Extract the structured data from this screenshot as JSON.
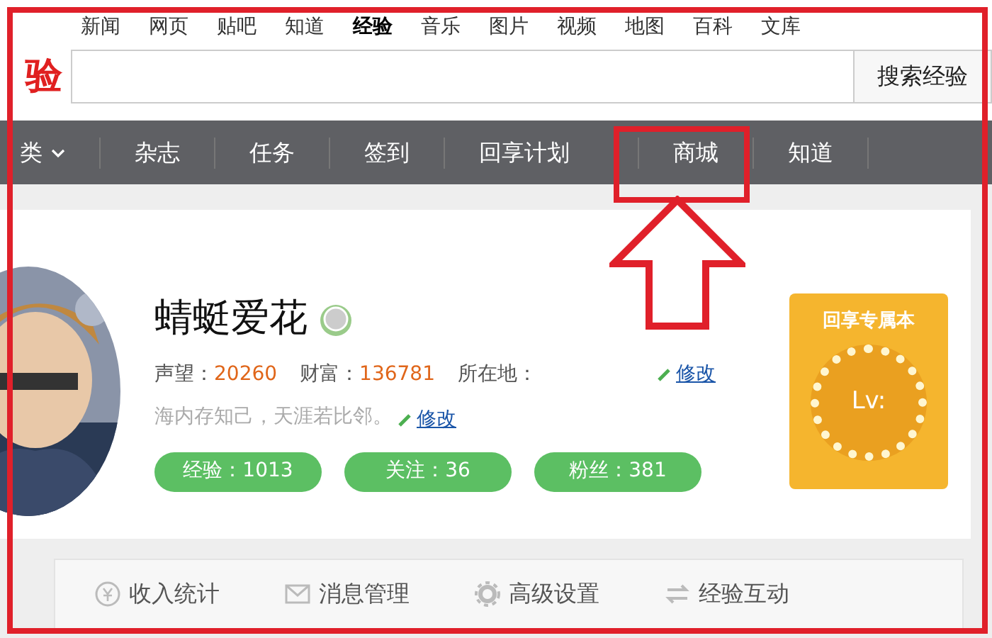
{
  "top_links": [
    {
      "label": "新闻",
      "selected": false
    },
    {
      "label": "网页",
      "selected": false
    },
    {
      "label": "贴吧",
      "selected": false
    },
    {
      "label": "知道",
      "selected": false
    },
    {
      "label": "经验",
      "selected": true
    },
    {
      "label": "音乐",
      "selected": false
    },
    {
      "label": "图片",
      "selected": false
    },
    {
      "label": "视频",
      "selected": false
    },
    {
      "label": "地图",
      "selected": false
    },
    {
      "label": "百科",
      "selected": false
    },
    {
      "label": "文库",
      "selected": false
    }
  ],
  "logo": "验",
  "search": {
    "button": "搜索经验"
  },
  "nav": [
    {
      "label": "类",
      "kind": "dropdown"
    },
    {
      "label": "杂志",
      "kind": "link"
    },
    {
      "label": "任务",
      "kind": "link"
    },
    {
      "label": "签到",
      "kind": "link"
    },
    {
      "label": "回享计划",
      "kind": "link"
    },
    {
      "label": "商城",
      "kind": "link"
    },
    {
      "label": "知道",
      "kind": "link"
    }
  ],
  "profile": {
    "name": "蜻蜓爱花",
    "stats": [
      {
        "label": "声望：",
        "value": "20260"
      },
      {
        "label": "财富：",
        "value": "136781"
      }
    ],
    "location_label": "所在地：",
    "edit": "修改",
    "motto": "海内存知己，天涯若比邻。",
    "motto_edit": "修改",
    "counts": [
      "经验：1013",
      "关注：36",
      "粉丝：381"
    ],
    "book": {
      "title": "回享专属本",
      "level": "Lv:"
    }
  },
  "tabs": [
    {
      "label": "收入统计"
    },
    {
      "label": "消息管理"
    },
    {
      "label": "高级设置"
    },
    {
      "label": "经验互动"
    }
  ]
}
